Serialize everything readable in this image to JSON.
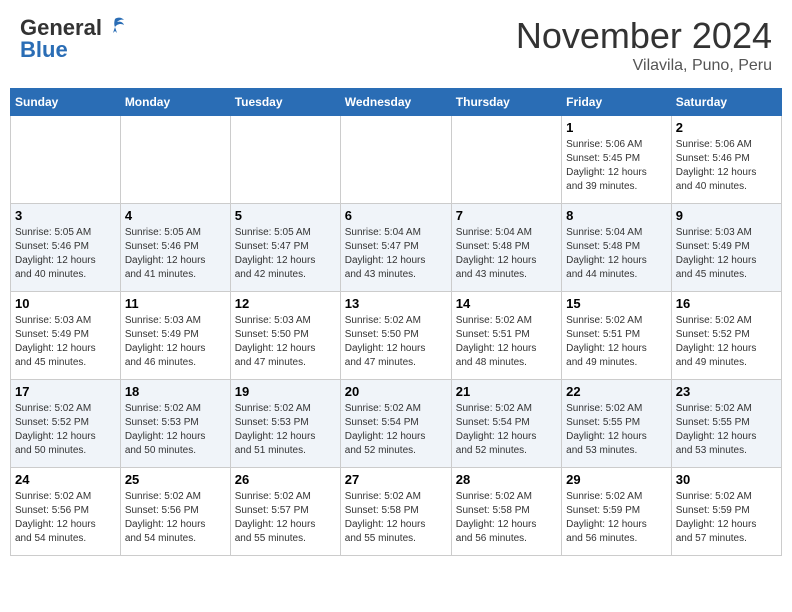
{
  "header": {
    "logo_general": "General",
    "logo_blue": "Blue",
    "month": "November 2024",
    "location": "Vilavila, Puno, Peru"
  },
  "weekdays": [
    "Sunday",
    "Monday",
    "Tuesday",
    "Wednesday",
    "Thursday",
    "Friday",
    "Saturday"
  ],
  "weeks": [
    [
      {
        "day": "",
        "info": ""
      },
      {
        "day": "",
        "info": ""
      },
      {
        "day": "",
        "info": ""
      },
      {
        "day": "",
        "info": ""
      },
      {
        "day": "",
        "info": ""
      },
      {
        "day": "1",
        "info": "Sunrise: 5:06 AM\nSunset: 5:45 PM\nDaylight: 12 hours\nand 39 minutes."
      },
      {
        "day": "2",
        "info": "Sunrise: 5:06 AM\nSunset: 5:46 PM\nDaylight: 12 hours\nand 40 minutes."
      }
    ],
    [
      {
        "day": "3",
        "info": "Sunrise: 5:05 AM\nSunset: 5:46 PM\nDaylight: 12 hours\nand 40 minutes."
      },
      {
        "day": "4",
        "info": "Sunrise: 5:05 AM\nSunset: 5:46 PM\nDaylight: 12 hours\nand 41 minutes."
      },
      {
        "day": "5",
        "info": "Sunrise: 5:05 AM\nSunset: 5:47 PM\nDaylight: 12 hours\nand 42 minutes."
      },
      {
        "day": "6",
        "info": "Sunrise: 5:04 AM\nSunset: 5:47 PM\nDaylight: 12 hours\nand 43 minutes."
      },
      {
        "day": "7",
        "info": "Sunrise: 5:04 AM\nSunset: 5:48 PM\nDaylight: 12 hours\nand 43 minutes."
      },
      {
        "day": "8",
        "info": "Sunrise: 5:04 AM\nSunset: 5:48 PM\nDaylight: 12 hours\nand 44 minutes."
      },
      {
        "day": "9",
        "info": "Sunrise: 5:03 AM\nSunset: 5:49 PM\nDaylight: 12 hours\nand 45 minutes."
      }
    ],
    [
      {
        "day": "10",
        "info": "Sunrise: 5:03 AM\nSunset: 5:49 PM\nDaylight: 12 hours\nand 45 minutes."
      },
      {
        "day": "11",
        "info": "Sunrise: 5:03 AM\nSunset: 5:49 PM\nDaylight: 12 hours\nand 46 minutes."
      },
      {
        "day": "12",
        "info": "Sunrise: 5:03 AM\nSunset: 5:50 PM\nDaylight: 12 hours\nand 47 minutes."
      },
      {
        "day": "13",
        "info": "Sunrise: 5:02 AM\nSunset: 5:50 PM\nDaylight: 12 hours\nand 47 minutes."
      },
      {
        "day": "14",
        "info": "Sunrise: 5:02 AM\nSunset: 5:51 PM\nDaylight: 12 hours\nand 48 minutes."
      },
      {
        "day": "15",
        "info": "Sunrise: 5:02 AM\nSunset: 5:51 PM\nDaylight: 12 hours\nand 49 minutes."
      },
      {
        "day": "16",
        "info": "Sunrise: 5:02 AM\nSunset: 5:52 PM\nDaylight: 12 hours\nand 49 minutes."
      }
    ],
    [
      {
        "day": "17",
        "info": "Sunrise: 5:02 AM\nSunset: 5:52 PM\nDaylight: 12 hours\nand 50 minutes."
      },
      {
        "day": "18",
        "info": "Sunrise: 5:02 AM\nSunset: 5:53 PM\nDaylight: 12 hours\nand 50 minutes."
      },
      {
        "day": "19",
        "info": "Sunrise: 5:02 AM\nSunset: 5:53 PM\nDaylight: 12 hours\nand 51 minutes."
      },
      {
        "day": "20",
        "info": "Sunrise: 5:02 AM\nSunset: 5:54 PM\nDaylight: 12 hours\nand 52 minutes."
      },
      {
        "day": "21",
        "info": "Sunrise: 5:02 AM\nSunset: 5:54 PM\nDaylight: 12 hours\nand 52 minutes."
      },
      {
        "day": "22",
        "info": "Sunrise: 5:02 AM\nSunset: 5:55 PM\nDaylight: 12 hours\nand 53 minutes."
      },
      {
        "day": "23",
        "info": "Sunrise: 5:02 AM\nSunset: 5:55 PM\nDaylight: 12 hours\nand 53 minutes."
      }
    ],
    [
      {
        "day": "24",
        "info": "Sunrise: 5:02 AM\nSunset: 5:56 PM\nDaylight: 12 hours\nand 54 minutes."
      },
      {
        "day": "25",
        "info": "Sunrise: 5:02 AM\nSunset: 5:56 PM\nDaylight: 12 hours\nand 54 minutes."
      },
      {
        "day": "26",
        "info": "Sunrise: 5:02 AM\nSunset: 5:57 PM\nDaylight: 12 hours\nand 55 minutes."
      },
      {
        "day": "27",
        "info": "Sunrise: 5:02 AM\nSunset: 5:58 PM\nDaylight: 12 hours\nand 55 minutes."
      },
      {
        "day": "28",
        "info": "Sunrise: 5:02 AM\nSunset: 5:58 PM\nDaylight: 12 hours\nand 56 minutes."
      },
      {
        "day": "29",
        "info": "Sunrise: 5:02 AM\nSunset: 5:59 PM\nDaylight: 12 hours\nand 56 minutes."
      },
      {
        "day": "30",
        "info": "Sunrise: 5:02 AM\nSunset: 5:59 PM\nDaylight: 12 hours\nand 57 minutes."
      }
    ]
  ]
}
